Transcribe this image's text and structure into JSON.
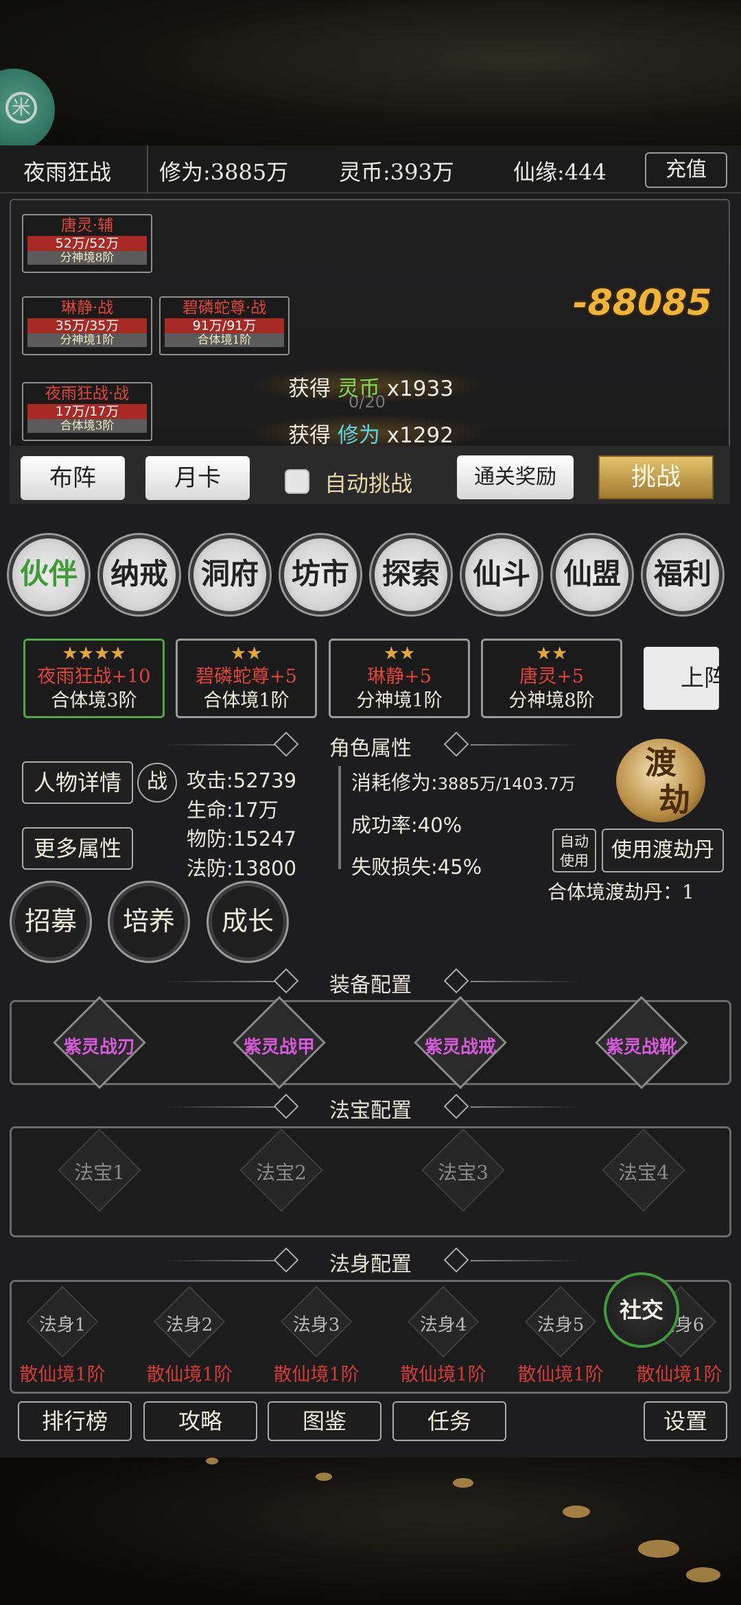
{
  "topbar": {
    "player_name": "夜雨狂战",
    "cultivation": "修为:3885万",
    "spirit_coin": "灵币:393万",
    "immortal_fate": "仙缘:444",
    "recharge": "充值"
  },
  "battle": {
    "units": [
      {
        "name": "唐灵·辅",
        "hp": "52万/52万",
        "rank": "分神境8阶"
      },
      {
        "name": "琳静·战",
        "hp": "35万/35万",
        "rank": "分神境1阶"
      },
      {
        "name": "碧磷蛇尊·战",
        "hp": "91万/91万",
        "rank": "合体境1阶"
      },
      {
        "name": "夜雨狂战·战",
        "hp": "17万/17万",
        "rank": "合体境3阶"
      }
    ],
    "damage": "-88085",
    "progress": "0/20",
    "rewards": [
      {
        "prefix": "获得",
        "item": "灵币",
        "amount": "x1933"
      },
      {
        "prefix": "获得",
        "item": "修为",
        "amount": "x1292"
      }
    ]
  },
  "actions": {
    "formation": "布阵",
    "monthly_card": "月卡",
    "auto_challenge": "自动挑战",
    "clear_reward": "通关奖励",
    "challenge": "挑战"
  },
  "menu": [
    "伙伴",
    "纳戒",
    "洞府",
    "坊市",
    "探索",
    "仙斗",
    "仙盟",
    "福利"
  ],
  "partners": [
    {
      "stars": "★★★★",
      "name": "夜雨狂战+10",
      "rank": "合体境3阶"
    },
    {
      "stars": "★★",
      "name": "碧磷蛇尊+5",
      "rank": "合体境1阶"
    },
    {
      "stars": "★★",
      "name": "琳静+5",
      "rank": "分神境1阶"
    },
    {
      "stars": "★★",
      "name": "唐灵+5",
      "rank": "分神境8阶"
    }
  ],
  "up_button": "上阵",
  "attributes": {
    "title": "角色属性",
    "details_btn": "人物详情",
    "battle_btn": "战",
    "more_btn": "更多属性",
    "attack": "攻击:52739",
    "life": "生命:17万",
    "phys_def": "物防:15247",
    "magic_def": "法防:13800",
    "consume": "消耗修为:",
    "consume_val": "3885万/1403.7万",
    "success": "成功率:40%",
    "fail_loss": "失败损失:45%",
    "tribulation_seal": [
      "渡",
      "劫"
    ],
    "auto_use": [
      "自动",
      "使用"
    ],
    "use_pill": "使用渡劫丹",
    "pill_count": "合体境渡劫丹：1"
  },
  "growth": [
    "招募",
    "培养",
    "成长"
  ],
  "equipment": {
    "title": "装备配置",
    "items": [
      "紫灵战刃",
      "紫灵战甲",
      "紫灵战戒",
      "紫灵战靴"
    ]
  },
  "treasure": {
    "title": "法宝配置",
    "items": [
      "法宝1",
      "法宝2",
      "法宝3",
      "法宝4"
    ]
  },
  "dharma_body": {
    "title": "法身配置",
    "items": [
      {
        "name": "法身1",
        "rank": "散仙境1阶"
      },
      {
        "name": "法身2",
        "rank": "散仙境1阶"
      },
      {
        "name": "法身3",
        "rank": "散仙境1阶"
      },
      {
        "name": "法身4",
        "rank": "散仙境1阶"
      },
      {
        "name": "法身5",
        "rank": "散仙境1阶"
      },
      {
        "name": "法身6",
        "rank": "散仙境1阶"
      }
    ]
  },
  "social": "社交",
  "bottom_nav": [
    "排行榜",
    "攻略",
    "图鉴",
    "任务",
    "设置"
  ],
  "colors": {
    "accent_green": "#4ea844",
    "enemy_red": "#e0443a",
    "gold": "#f0b437",
    "purple_equip": "#d65ad9"
  }
}
